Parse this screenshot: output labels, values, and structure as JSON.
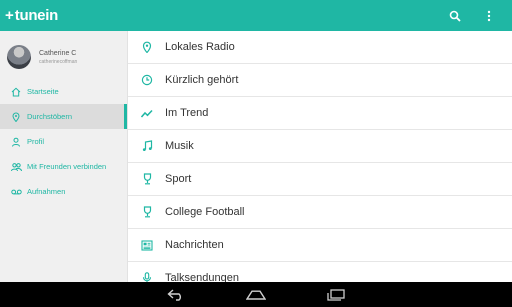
{
  "app": {
    "logo_mark": "+",
    "logo_text": "tunein"
  },
  "colors": {
    "accent": "#1fb7a4",
    "sidebar_bg": "#f0f0f0",
    "active_bg": "#dcdcdc",
    "nav_bar": "#000000"
  },
  "icons": {
    "top": [
      "search-icon",
      "overflow-menu-icon"
    ],
    "system": [
      "back-icon",
      "home-icon",
      "recent-apps-icon"
    ]
  },
  "user": {
    "name": "Catherine C",
    "handle": "catherinecoffman"
  },
  "sidebar": {
    "items": [
      {
        "label": "Startseite",
        "icon": "home-icon",
        "active": false
      },
      {
        "label": "Durchstöbern",
        "icon": "location-pin-icon",
        "active": true
      },
      {
        "label": "Profil",
        "icon": "person-icon",
        "active": false
      },
      {
        "label": "Mit Freunden verbinden",
        "icon": "friends-icon",
        "active": false
      },
      {
        "label": "Aufnahmen",
        "icon": "voicemail-icon",
        "active": false
      }
    ]
  },
  "browse": {
    "items": [
      {
        "label": "Lokales Radio",
        "icon": "location-pin-icon"
      },
      {
        "label": "Kürzlich gehört",
        "icon": "clock-icon"
      },
      {
        "label": "Im Trend",
        "icon": "trend-icon"
      },
      {
        "label": "Musik",
        "icon": "music-note-icon"
      },
      {
        "label": "Sport",
        "icon": "trophy-icon"
      },
      {
        "label": "College Football",
        "icon": "trophy-icon"
      },
      {
        "label": "Nachrichten",
        "icon": "newspaper-icon"
      },
      {
        "label": "Talksendungen",
        "icon": "microphone-icon"
      }
    ]
  }
}
